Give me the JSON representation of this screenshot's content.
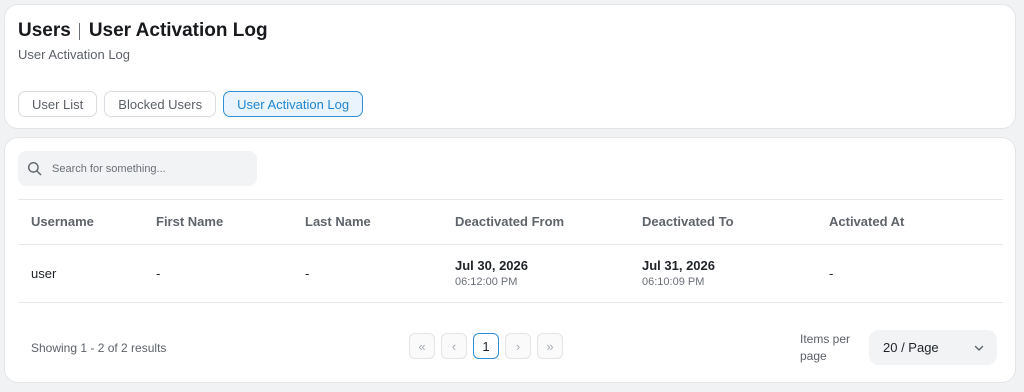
{
  "header": {
    "breadcrumb_root": "Users",
    "title": "User Activation Log",
    "subtitle": "User Activation Log",
    "tabs": [
      {
        "label": "User List",
        "active": false
      },
      {
        "label": "Blocked Users",
        "active": false
      },
      {
        "label": "User Activation Log",
        "active": true
      }
    ]
  },
  "search": {
    "placeholder": "Search for something...",
    "icon": "search-icon"
  },
  "table": {
    "columns": [
      "Username",
      "First Name",
      "Last Name",
      "Deactivated From",
      "Deactivated To",
      "Activated At"
    ],
    "rows": [
      {
        "username": "user",
        "first_name": "-",
        "last_name": "-",
        "deactivated_from_date": "Jul 30, 2026",
        "deactivated_from_time": "06:12:00 PM",
        "deactivated_to_date": "Jul 31, 2026",
        "deactivated_to_time": "06:10:09 PM",
        "activated_at": "-"
      }
    ]
  },
  "footer": {
    "showing": "Showing 1 - 2 of 2 results",
    "pager": {
      "first": "«",
      "prev": "‹",
      "current_page": "1",
      "next": "›",
      "last": "»"
    },
    "items_per_page_label": "Items per page",
    "page_size": "20 / Page"
  },
  "colors": {
    "accent": "#2f8fd5",
    "active_tab_bg": "#eaf4fc",
    "page_bg": "#f1f2f4"
  }
}
